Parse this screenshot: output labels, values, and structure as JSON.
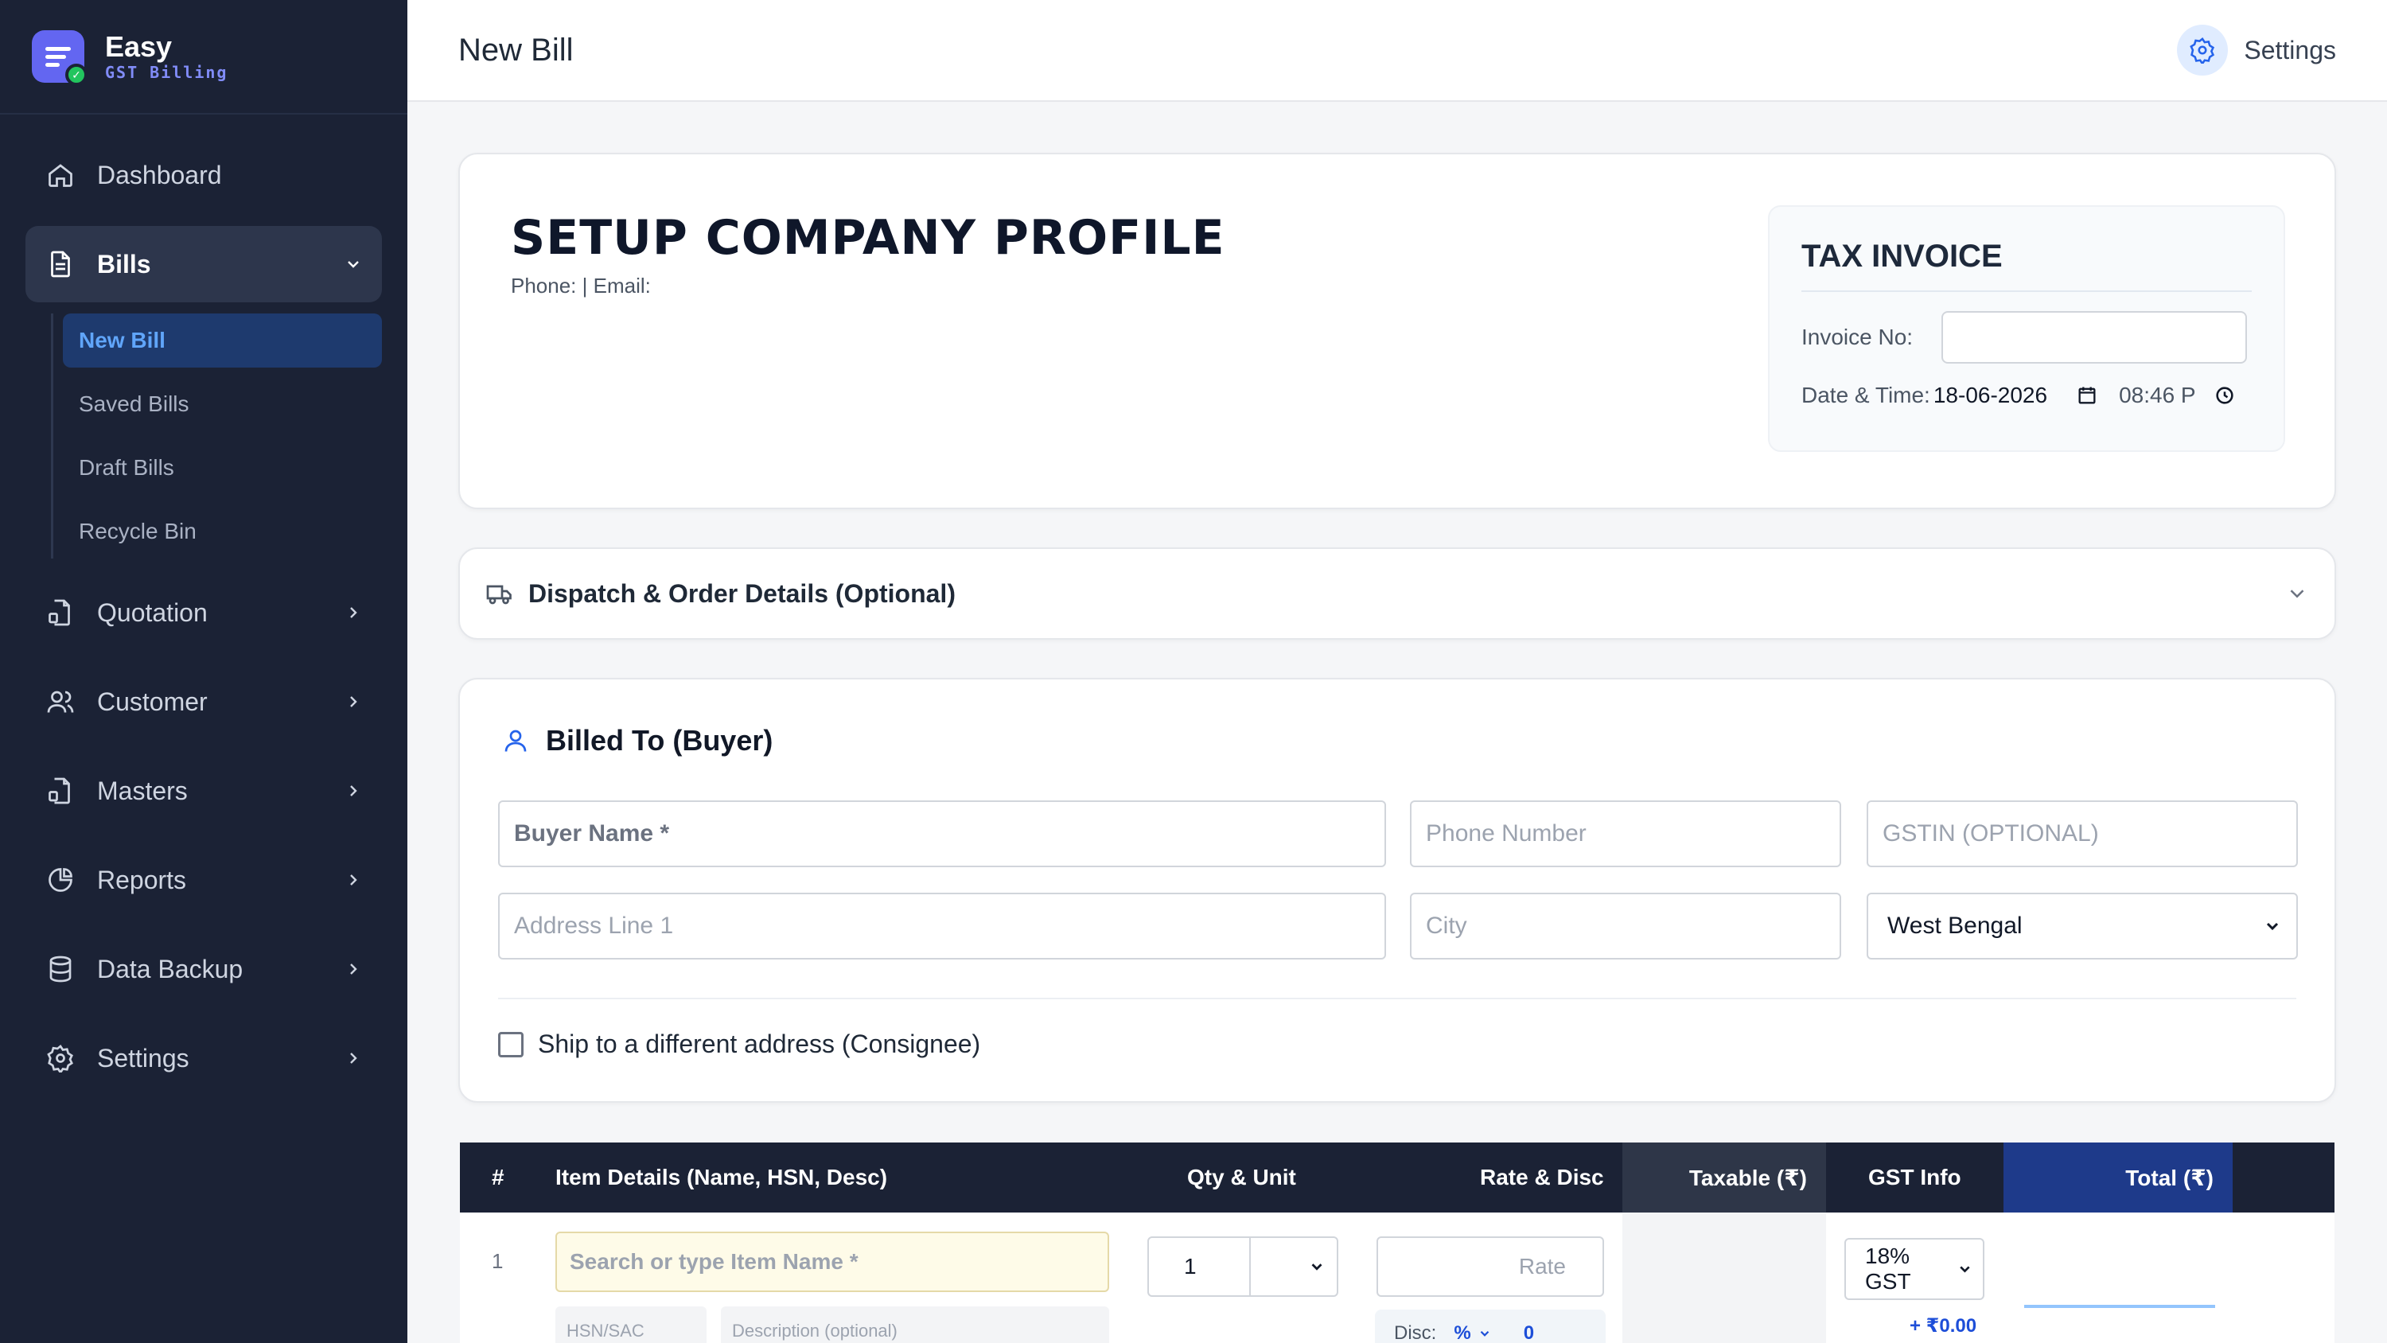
{
  "brand": {
    "name": "Easy",
    "sub": "GST Billing"
  },
  "sidebar": {
    "items": [
      {
        "label": "Dashboard"
      },
      {
        "label": "Bills"
      },
      {
        "label": "Quotation"
      },
      {
        "label": "Customer"
      },
      {
        "label": "Masters"
      },
      {
        "label": "Reports"
      },
      {
        "label": "Data Backup"
      },
      {
        "label": "Settings"
      }
    ],
    "bills_sub": [
      "New Bill",
      "Saved Bills",
      "Draft Bills",
      "Recycle Bin"
    ]
  },
  "header": {
    "title": "New Bill",
    "settings_label": "Settings"
  },
  "company": {
    "title": "SETUP COMPANY PROFILE",
    "contact": "Phone: | Email:"
  },
  "invoice": {
    "title": "TAX INVOICE",
    "no_label": "Invoice No:",
    "no_value": "",
    "datetime_label": "Date & Time:",
    "date": "18-06-2026",
    "time": "08:46 P"
  },
  "dispatch": {
    "title": "Dispatch & Order Details (Optional)"
  },
  "buyer": {
    "heading": "Billed To (Buyer)",
    "name_placeholder": "Buyer Name *",
    "phone_placeholder": "Phone Number",
    "gstin_placeholder": "GSTIN (OPTIONAL)",
    "address_placeholder": "Address Line 1",
    "city_placeholder": "City",
    "state": "West Bengal",
    "ship_label": "Ship to a different address (Consignee)"
  },
  "items_table": {
    "headers": [
      "#",
      "Item Details (Name, HSN, Desc)",
      "Qty & Unit",
      "Rate & Disc",
      "Taxable (₹)",
      "GST Info",
      "Total (₹)"
    ],
    "rows": [
      {
        "num": "1",
        "item_placeholder": "Search or type Item Name *",
        "hsn_placeholder": "HSN/SAC",
        "desc_placeholder": "Description (optional)",
        "qty": "1",
        "rate_placeholder": "Rate",
        "disc_label": "Disc:",
        "disc_type": "%",
        "disc_value": "0",
        "gst": "18% GST",
        "gst_amount": "+ ₹0.00"
      }
    ]
  },
  "colors": {
    "sidebar": "#1b2235",
    "accent": "#6366f1",
    "active_sub": "#60a5fa",
    "total_header": "#1e3a8a"
  }
}
